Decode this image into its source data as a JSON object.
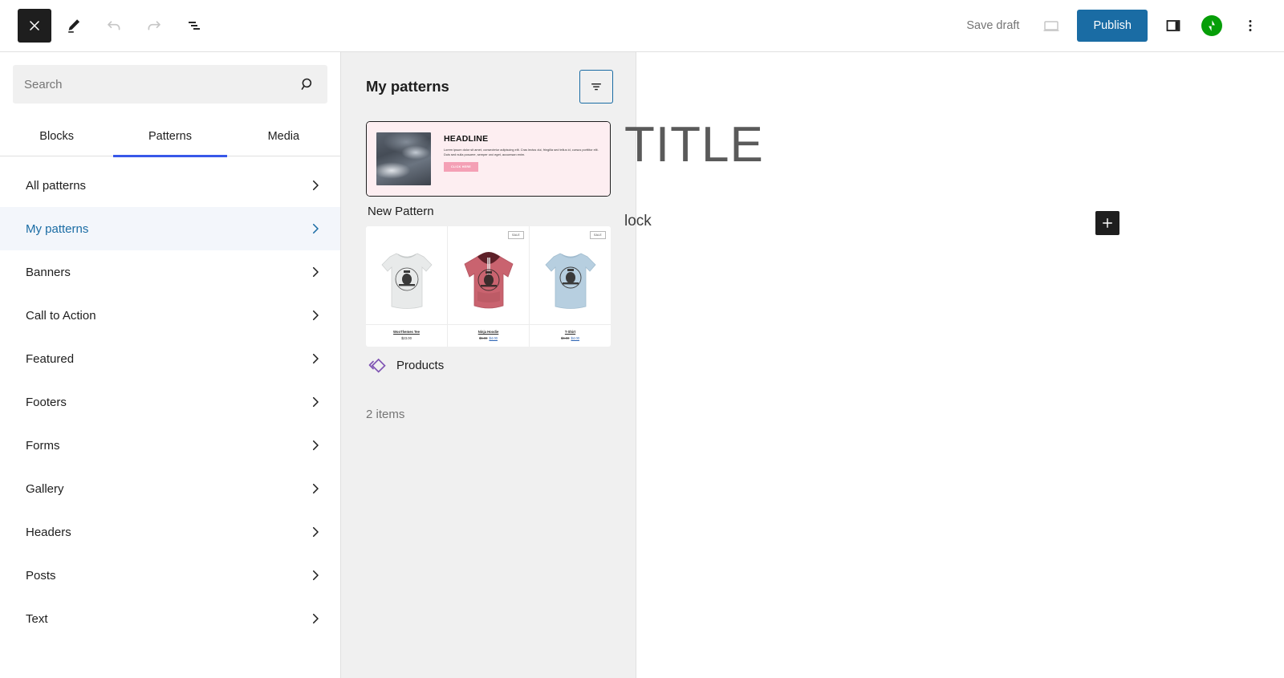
{
  "toolbar": {
    "close_label": "Close",
    "close_icon": "close-x-icon",
    "edit_icon": "pencil-edit-icon",
    "undo_icon": "undo-arrow-icon",
    "redo_icon": "redo-arrow-icon",
    "listview_icon": "list-view-icon",
    "save_draft_label": "Save draft",
    "preview_icon": "desktop-preview-icon",
    "publish_label": "Publish",
    "sidebar_toggle_icon": "settings-sidebar-icon",
    "jetpack_icon": "jetpack-icon",
    "more_options_icon": "more-vertical-icon",
    "publish_color": "#1a6ca4",
    "jetpack_color": "#069e08"
  },
  "inserter": {
    "search": {
      "placeholder": "Search",
      "value": "",
      "icon": "search-icon"
    },
    "tabs": [
      {
        "label": "Blocks",
        "active": false
      },
      {
        "label": "Patterns",
        "active": true
      },
      {
        "label": "Media",
        "active": false
      }
    ],
    "active_tab_color": "#3858e9",
    "categories": [
      {
        "label": "All patterns",
        "selected": false
      },
      {
        "label": "My patterns",
        "selected": true
      },
      {
        "label": "Banners",
        "selected": false
      },
      {
        "label": "Call to Action",
        "selected": false
      },
      {
        "label": "Featured",
        "selected": false
      },
      {
        "label": "Footers",
        "selected": false
      },
      {
        "label": "Forms",
        "selected": false
      },
      {
        "label": "Gallery",
        "selected": false
      },
      {
        "label": "Headers",
        "selected": false
      },
      {
        "label": "Posts",
        "selected": false
      },
      {
        "label": "Text",
        "selected": false
      }
    ],
    "chevron_icon": "chevron-right-icon",
    "selected_color": "#1a6ca4"
  },
  "patterns_panel": {
    "title": "My patterns",
    "filter_icon": "filter-funnel-icon",
    "filter_accent": "#1a6ca4",
    "items_count_label": "2 items",
    "patterns": [
      {
        "label": "New Pattern",
        "selected": true,
        "preview": {
          "kind": "hero",
          "background": "#fdeef1",
          "headline": "HEADLINE",
          "body": "Lorem ipsum dolor sit amet, consectetur adipiscing elit. Cras lectus dui, fringilla sed tellus id, cursus porttitor elit. Duis sed nulla posuere, semper orci eget, accumsan enim.",
          "button_label": "CLICK HERE",
          "button_color": "#f4a0b5"
        }
      },
      {
        "label": "Products",
        "selected": false,
        "icon": "synced-pattern-icon",
        "icon_color": "#7f54b3",
        "preview": {
          "kind": "products",
          "sale_badge": "SALE",
          "products": [
            {
              "name": "WooThemes Tee",
              "price": "$23.00",
              "was": "",
              "now": "",
              "on_sale": false,
              "color": "#e8e8e8"
            },
            {
              "name": "Ninja Hoodie",
              "price": "",
              "was": "$5.00",
              "now": "$4.00",
              "on_sale": true,
              "color": "#c9636f"
            },
            {
              "name": "T-Shirt",
              "price": "",
              "was": "$6.00",
              "now": "$4.00",
              "on_sale": true,
              "color": "#b7cfe0"
            }
          ]
        }
      }
    ]
  },
  "canvas": {
    "post_title": "TITLE",
    "post_body": "lock",
    "block_inserter_icon": "plus-icon"
  }
}
